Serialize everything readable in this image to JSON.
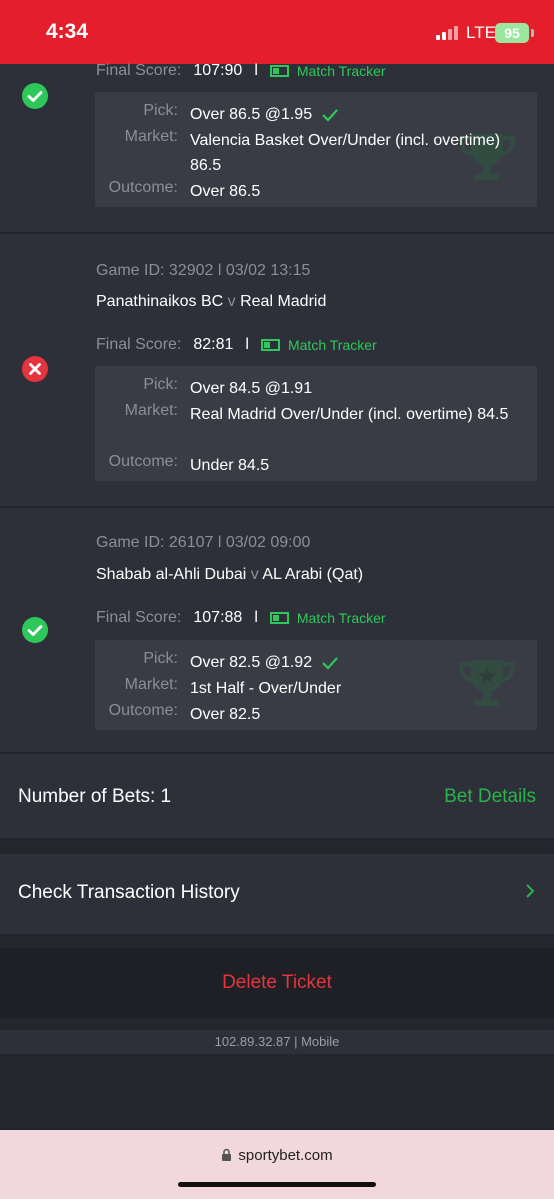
{
  "status_bar": {
    "time": "4:34",
    "network": "LTE",
    "battery": "95"
  },
  "bets": [
    {
      "result": "won",
      "final_score_label": "Final Score:",
      "score": "107:90",
      "tracker": "Match Tracker",
      "pick_label": "Pick:",
      "pick": "Over 86.5 @1.95",
      "market_label": "Market:",
      "market": "Valencia Basket Over/Under (incl. overtime) 86.5",
      "outcome_label": "Outcome:",
      "outcome": "Over 86.5"
    },
    {
      "result": "lost",
      "game_meta": "Game ID: 32902 l 03/02 13:15",
      "home": "Panathinaikos BC",
      "vs": "v",
      "away": "Real Madrid",
      "final_score_label": "Final Score:",
      "score": "82:81",
      "tracker": "Match Tracker",
      "pick_label": "Pick:",
      "pick": "Over 84.5 @1.91",
      "market_label": "Market:",
      "market": "Real Madrid Over/Under (incl. overtime) 84.5",
      "outcome_label": "Outcome:",
      "outcome": "Under 84.5"
    },
    {
      "result": "won",
      "game_meta": "Game ID: 26107 l 03/02 09:00",
      "home": "Shabab al-Ahli Dubai",
      "vs": "v",
      "away": "AL Arabi (Qat)",
      "final_score_label": "Final Score:",
      "score": "107:88",
      "tracker": "Match Tracker",
      "pick_label": "Pick:",
      "pick": "Over 82.5 @1.92",
      "market_label": "Market:",
      "market": "1st Half - Over/Under",
      "outcome_label": "Outcome:",
      "outcome": "Over 82.5"
    }
  ],
  "summary": {
    "label": "Number of Bets: 1",
    "details_link": "Bet Details"
  },
  "history": {
    "label": "Check Transaction History"
  },
  "delete": {
    "label": "Delete Ticket"
  },
  "footer": {
    "ip_info": "102.89.32.87 | Mobile"
  },
  "browser": {
    "url": "sportybet.com"
  },
  "colors": {
    "accent_green": "#2ab44a",
    "loss_red": "#e5343e",
    "status_red": "#e41e2b"
  }
}
